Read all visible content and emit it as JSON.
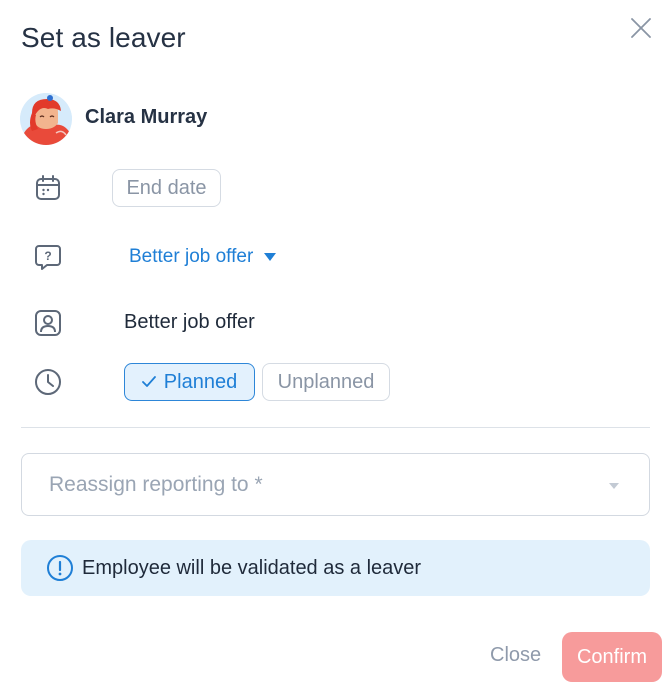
{
  "dialog": {
    "title": "Set as leaver",
    "close_icon": "close-icon"
  },
  "employee": {
    "name": "Clara Murray",
    "avatar_icon": "avatar-illustration"
  },
  "fields": {
    "end_date": {
      "icon": "calendar-icon",
      "placeholder": "End date"
    },
    "reason": {
      "icon": "question-bubble-icon",
      "selected": "Better job offer",
      "caret_icon": "caret-down-icon"
    },
    "reason_detail": {
      "icon": "person-badge-icon",
      "value": "Better job offer"
    },
    "departure_type": {
      "icon": "clock-icon",
      "options": [
        {
          "label": "Planned",
          "selected": true,
          "icon": "check-icon"
        },
        {
          "label": "Unplanned",
          "selected": false
        }
      ]
    }
  },
  "reassign": {
    "placeholder": "Reassign reporting to *",
    "caret_icon": "caret-down-icon"
  },
  "info": {
    "icon": "info-icon",
    "message": "Employee will be validated as a leaver"
  },
  "actions": {
    "close_label": "Close",
    "confirm_label": "Confirm"
  },
  "colors": {
    "accent": "#1f7fd6",
    "selected_bg": "#e3f1fd",
    "info_bg": "#e2f1fc",
    "confirm_bg": "#f79b9b",
    "muted_text": "#8a95a5"
  }
}
